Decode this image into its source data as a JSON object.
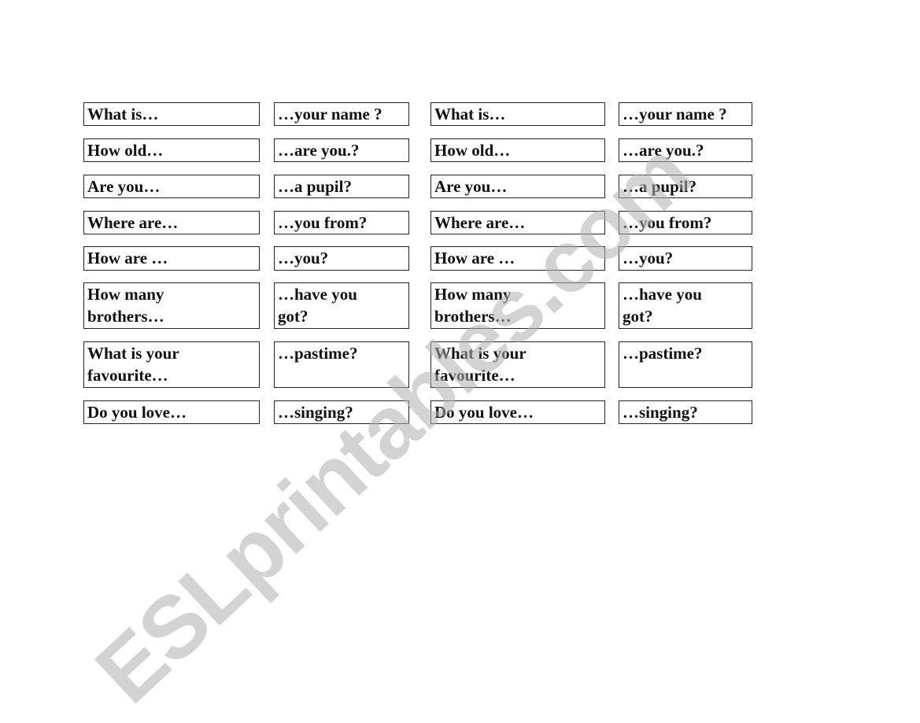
{
  "rows": [
    {
      "question": "What is…",
      "answer": "…your name ?"
    },
    {
      "question": "How old…",
      "answer": "…are you.?"
    },
    {
      "question": "Are you…",
      "answer": "…a pupil?"
    },
    {
      "question": "Where are…",
      "answer": "…you from?"
    },
    {
      "question": "How are …",
      "answer": "…you?"
    },
    {
      "question": "How many\nbrothers…",
      "answer": "…have you\ngot?"
    },
    {
      "question": "What is your\nfavourite…",
      "answer": "…pastime?"
    },
    {
      "question": "Do you love…",
      "answer": "…singing?"
    }
  ],
  "watermark": "ESLprintables.com"
}
